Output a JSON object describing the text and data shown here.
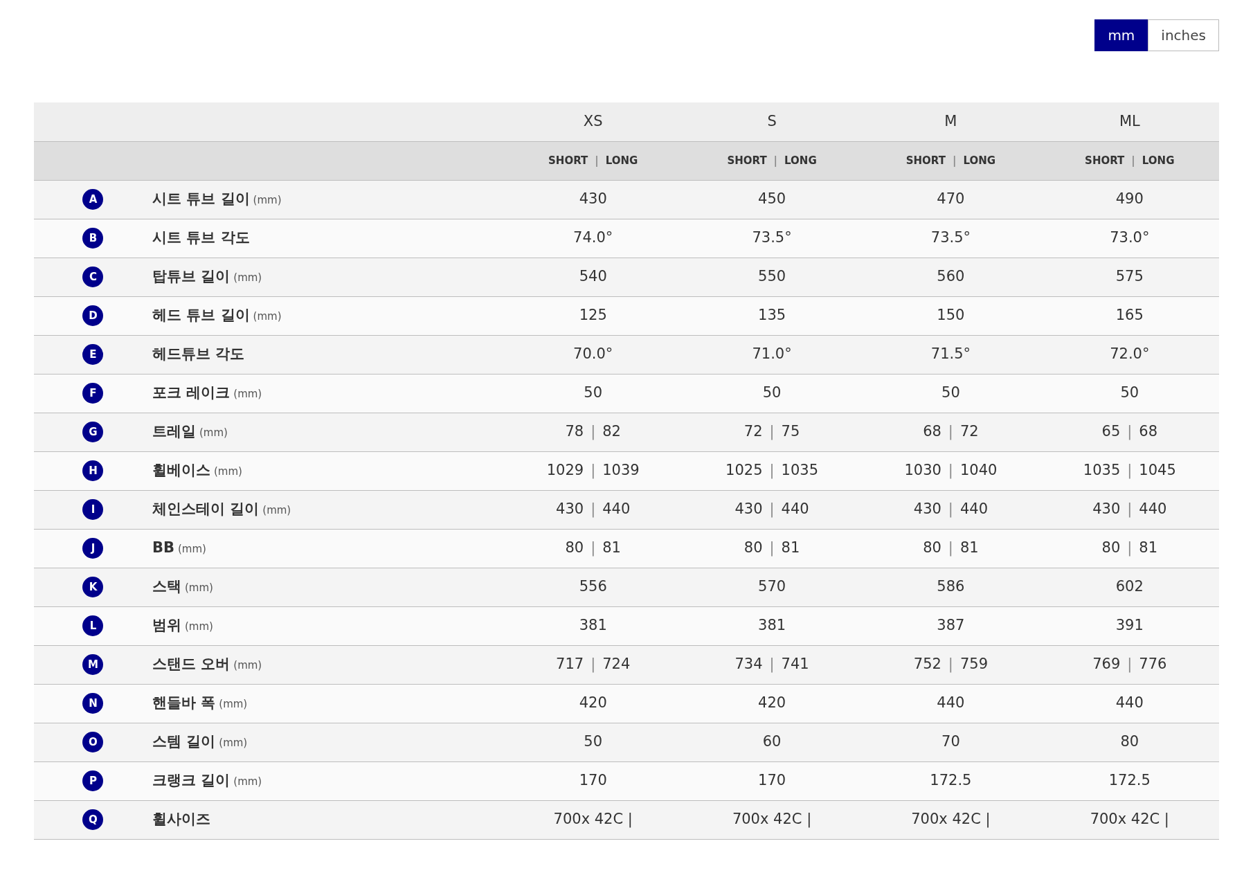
{
  "unit_toggle": [
    {
      "label": "mm",
      "selected": true
    },
    {
      "label": "inches",
      "selected": false
    }
  ],
  "table": {
    "sizes": [
      "XS",
      "S",
      "M",
      "ML"
    ],
    "subheaders": [
      {
        "short": "SHORT",
        "separator": "|",
        "long": "LONG"
      },
      {
        "short": "SHORT",
        "separator": "|",
        "long": "LONG"
      },
      {
        "short": "SHORT",
        "separator": "|",
        "long": "LONG"
      },
      {
        "short": "SHORT",
        "separator": "|",
        "long": "LONG"
      }
    ],
    "rows": [
      {
        "letter": "A",
        "label": "시트 튜브 길이",
        "unit": "(mm)",
        "values": [
          [
            "430"
          ],
          [
            "450"
          ],
          [
            "470"
          ],
          [
            "490"
          ]
        ]
      },
      {
        "letter": "B",
        "label": "시트 튜브 각도",
        "values": [
          [
            "74.0°"
          ],
          [
            "73.5°"
          ],
          [
            "73.5°"
          ],
          [
            "73.0°"
          ]
        ]
      },
      {
        "letter": "C",
        "label": "탑튜브 길이",
        "unit": "(mm)",
        "values": [
          [
            "540"
          ],
          [
            "550"
          ],
          [
            "560"
          ],
          [
            "575"
          ]
        ]
      },
      {
        "letter": "D",
        "label": "헤드 튜브 길이",
        "unit": "(mm)",
        "values": [
          [
            "125"
          ],
          [
            "135"
          ],
          [
            "150"
          ],
          [
            "165"
          ]
        ]
      },
      {
        "letter": "E",
        "label": "헤드튜브 각도",
        "values": [
          [
            "70.0°"
          ],
          [
            "71.0°"
          ],
          [
            "71.5°"
          ],
          [
            "72.0°"
          ]
        ]
      },
      {
        "letter": "F",
        "label": "포크 레이크",
        "unit": "(mm)",
        "values": [
          [
            "50"
          ],
          [
            "50"
          ],
          [
            "50"
          ],
          [
            "50"
          ]
        ]
      },
      {
        "letter": "G",
        "label": "트레일",
        "unit": "(mm)",
        "values": [
          [
            "78",
            "82"
          ],
          [
            "72",
            "75"
          ],
          [
            "68",
            "72"
          ],
          [
            "65",
            "68"
          ]
        ]
      },
      {
        "letter": "H",
        "label": "휠베이스",
        "unit": "(mm)",
        "values": [
          [
            "1029",
            "1039"
          ],
          [
            "1025",
            "1035"
          ],
          [
            "1030",
            "1040"
          ],
          [
            "1035",
            "1045"
          ]
        ]
      },
      {
        "letter": "I",
        "label": "체인스테이 길이",
        "unit": "(mm)",
        "values": [
          [
            "430",
            "440"
          ],
          [
            "430",
            "440"
          ],
          [
            "430",
            "440"
          ],
          [
            "430",
            "440"
          ]
        ]
      },
      {
        "letter": "J",
        "label": "BB",
        "unit": "(mm)",
        "values": [
          [
            "80",
            "81"
          ],
          [
            "80",
            "81"
          ],
          [
            "80",
            "81"
          ],
          [
            "80",
            "81"
          ]
        ]
      },
      {
        "letter": "K",
        "label": "스택",
        "unit": "(mm)",
        "values": [
          [
            "556"
          ],
          [
            "570"
          ],
          [
            "586"
          ],
          [
            "602"
          ]
        ]
      },
      {
        "letter": "L",
        "label": "범위",
        "unit": "(mm)",
        "values": [
          [
            "381"
          ],
          [
            "381"
          ],
          [
            "387"
          ],
          [
            "391"
          ]
        ]
      },
      {
        "letter": "M",
        "label": "스탠드 오버",
        "unit": "(mm)",
        "values": [
          [
            "717",
            "724"
          ],
          [
            "734",
            "741"
          ],
          [
            "752",
            "759"
          ],
          [
            "769",
            "776"
          ]
        ]
      },
      {
        "letter": "N",
        "label": "핸들바 폭",
        "unit": "(mm)",
        "values": [
          [
            "420"
          ],
          [
            "420"
          ],
          [
            "440"
          ],
          [
            "440"
          ]
        ]
      },
      {
        "letter": "O",
        "label": "스템 길이",
        "unit": "(mm)",
        "values": [
          [
            "50"
          ],
          [
            "60"
          ],
          [
            "70"
          ],
          [
            "80"
          ]
        ]
      },
      {
        "letter": "P",
        "label": "크랭크 길이",
        "unit": "(mm)",
        "values": [
          [
            "170"
          ],
          [
            "170"
          ],
          [
            "172.5"
          ],
          [
            "172.5"
          ]
        ]
      },
      {
        "letter": "Q",
        "label": "휠사이즈",
        "values": [
          [
            "700x 42C |"
          ],
          [
            "700x 42C |"
          ],
          [
            "700x 42C |"
          ],
          [
            "700x 42C |"
          ]
        ]
      }
    ]
  }
}
